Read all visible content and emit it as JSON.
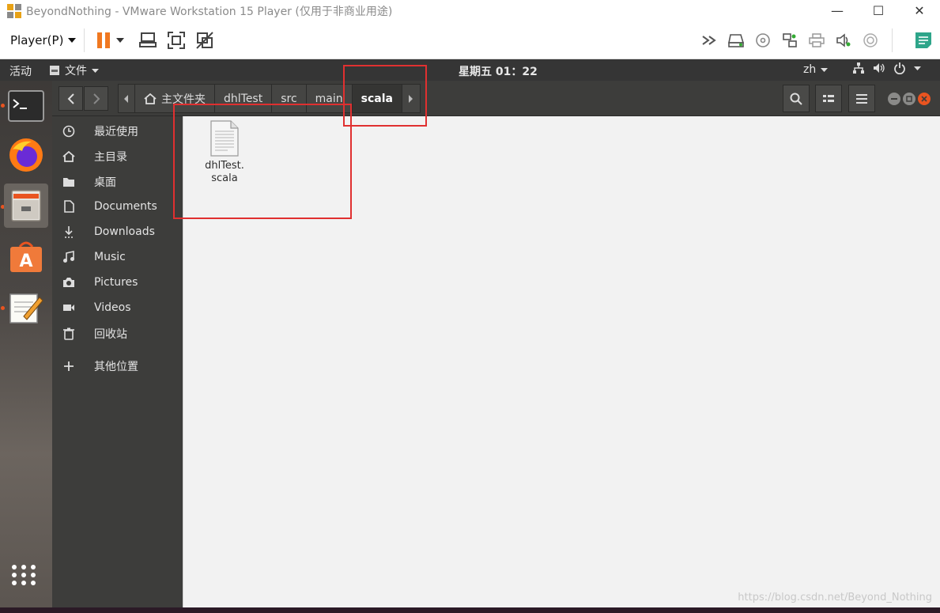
{
  "vmware": {
    "window_title": "BeyondNothing - VMware Workstation 15 Player (仅用于非商业用途)",
    "minimize": "—",
    "maximize": "☐",
    "close": "✕",
    "player_menu": "Player(P)",
    "toolbar_icons": [
      "pause-icon",
      "send-ctrl-alt-del-icon",
      "fit-guest-icon",
      "unity-disabled-icon"
    ],
    "device_icons": [
      "network-icon",
      "hard-disk-icon",
      "cd-icon",
      "usb-icon",
      "printer-icon",
      "sound-icon",
      "display-icon"
    ],
    "accent": "#f07820"
  },
  "ubuntu_topbar": {
    "activities": "活动",
    "app_menu": "文件",
    "clock": "星期五 01：22",
    "language": "zh"
  },
  "dock": {
    "apps": [
      "terminal",
      "firefox",
      "files",
      "software-center",
      "text-editor"
    ],
    "running_indicator_color": "#e95420"
  },
  "nautilus": {
    "path": [
      {
        "label": "主文件夹",
        "icon": "home-icon"
      },
      {
        "label": "dhlTest"
      },
      {
        "label": "src"
      },
      {
        "label": "main"
      },
      {
        "label": "scala",
        "active": true
      }
    ],
    "sidebar": [
      {
        "label": "最近使用",
        "icon": "recent-icon"
      },
      {
        "label": "主目录",
        "icon": "home-icon"
      },
      {
        "label": "桌面",
        "icon": "desktop-folder-icon"
      },
      {
        "label": "Documents",
        "icon": "document-icon"
      },
      {
        "label": "Downloads",
        "icon": "download-icon"
      },
      {
        "label": "Music",
        "icon": "music-icon"
      },
      {
        "label": "Pictures",
        "icon": "camera-icon"
      },
      {
        "label": "Videos",
        "icon": "video-icon"
      },
      {
        "label": "回收站",
        "icon": "trash-icon"
      },
      {
        "label": "其他位置",
        "icon": "plus-icon"
      }
    ],
    "files": [
      {
        "line1": "dhlTest.",
        "line2": "scala",
        "icon": "text-file-icon"
      }
    ]
  },
  "watermark": "https://blog.csdn.net/Beyond_Nothing"
}
